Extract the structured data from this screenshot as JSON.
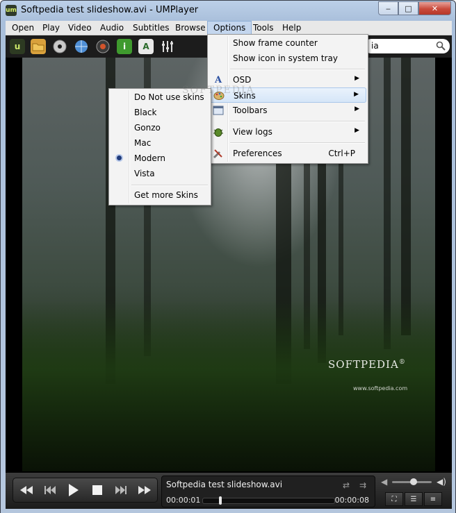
{
  "window": {
    "title": "Softpedia test slideshow.avi - UMPlayer",
    "app_icon_text": "um",
    "buttons": {
      "minimize": "‒",
      "maximize": "□",
      "close": "✕"
    }
  },
  "menubar": {
    "items": [
      "Open",
      "Play",
      "Video",
      "Audio",
      "Subtitles",
      "Browse",
      "Options",
      "Tools",
      "Help"
    ],
    "active": "Options"
  },
  "toolbar": {
    "icons": [
      "um-logo-icon",
      "folder-icon",
      "disc-icon",
      "globe-icon",
      "webcam-icon",
      "info-icon",
      "subtitle-add-icon",
      "equalizer-icon"
    ],
    "search_value": "ia",
    "search_icon": "magnifier-icon"
  },
  "options_menu": {
    "items": [
      {
        "label": "Show frame counter"
      },
      {
        "label": "Show icon in system tray"
      },
      {
        "label": "OSD",
        "submenu": true,
        "icon": "font-icon"
      },
      {
        "label": "Skins",
        "submenu": true,
        "icon": "palette-icon",
        "highlighted": true
      },
      {
        "label": "Toolbars",
        "submenu": true,
        "icon": "toolbar-icon"
      },
      {
        "label": "View logs",
        "submenu": true,
        "icon": "bug-icon"
      },
      {
        "label": "Preferences",
        "shortcut": "Ctrl+P",
        "icon": "tools-icon"
      }
    ]
  },
  "skins_menu": {
    "items": [
      {
        "label": "Do Not use skins"
      },
      {
        "label": "Black"
      },
      {
        "label": "Gonzo"
      },
      {
        "label": "Mac"
      },
      {
        "label": "Modern",
        "selected": true
      },
      {
        "label": "Vista"
      },
      {
        "label": "Get more Skins"
      }
    ]
  },
  "video": {
    "logo_text": "SOFTPEDIA",
    "logo_mark": "®",
    "url_text": "www.softpedia.com",
    "watermark": "SOFTPEDIA"
  },
  "controls": {
    "filename": "Softpedia test slideshow.avi",
    "time_current": "00:00:01",
    "time_total": "00:00:08",
    "seek_fraction": 0.12,
    "volume_fraction": 0.55,
    "buttons": [
      "rewind-icon",
      "previous-icon",
      "play-icon",
      "stop-icon",
      "next-icon",
      "fast-forward-icon"
    ]
  },
  "colors": {
    "menu_highlight": "#c4d6ee",
    "toolbar_bg": "#1c1c1c",
    "controls_bg": "#2a2a2a"
  }
}
